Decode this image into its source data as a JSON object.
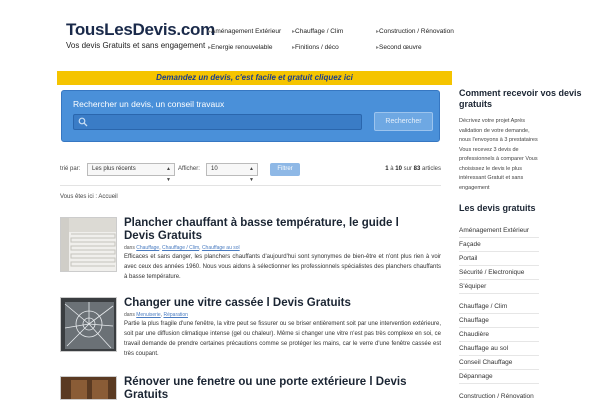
{
  "header": {
    "logo": "TousLesDevis.com",
    "tagline": "Vos devis Gratuits et sans engagement",
    "nav_col1": [
      "Aménagement Extérieur",
      "Energie renouvelable"
    ],
    "nav_col2": [
      "Chauffage / Clim",
      "Finitions / déco"
    ],
    "nav_col3": [
      "Construction / Rénovation",
      "Second œuvre"
    ]
  },
  "banner": "Demandez un devis, c'est facile et gratuit cliquez ici",
  "search": {
    "title": "Rechercher un devis, un conseil travaux",
    "placeholder": "",
    "button": "Rechercher"
  },
  "filters": {
    "sort_label": "trié par:",
    "sort_value": "Les plus récents",
    "show_label": "Afficher:",
    "show_value": "10",
    "filter_button": "Filtrer",
    "count_from": "1",
    "count_sep": "à",
    "count_to": "10",
    "count_of": "sur",
    "count_total": "83",
    "count_suffix": "articles"
  },
  "breadcrumb": "Vous êtes ici : Accueil",
  "articles": [
    {
      "title": "Plancher chauffant à basse température, le guide l Devis Gratuits",
      "meta_prefix": "dans",
      "tags": [
        "Chauffage",
        "Chauffage / Clim",
        "Chauffage au sol"
      ],
      "excerpt": "Efficaces et sans danger, les planchers chauffants d'aujourd'hui sont synonymes de bien-être et n'ont plus rien à voir avec ceux des années 1960. Nous vous aidons à sélectionner les professionnels spécialistes des planchers chauffants à basse température."
    },
    {
      "title": "Changer une vitre cassée l Devis Gratuits",
      "meta_prefix": "dans",
      "tags": [
        "Menuiserie",
        "Réparation"
      ],
      "excerpt": "Partie la plus fragile d'une fenêtre, la vitre peut se fissurer ou se briser entièrement soit par une intervention extérieure, soit par une diffusion climatique intense (gel ou chaleur). Même si changer une vitre n'est pas très complexe en soi, ce travail demande de prendre certaines précautions comme se protéger les mains, car le verre d'une fenêtre cassée est très coupant."
    },
    {
      "title": "Rénover une fenetre ou une porte extérieure l Devis Gratuits"
    }
  ],
  "sidebar": {
    "heading1": "Comment recevoir vos devis gratuits",
    "text": "Décrivez votre projet Après validation de votre demande, nous l'envoyons à 3 prestataires Vous recevez 3 devis de professionnels à comparer Vous choisissez le devis le plus intéressant Gratuit et sans engagement",
    "heading2": "Les devis gratuits",
    "items": [
      "Aménagement Extérieur",
      "Façade",
      "Portail",
      "Sécurité / Electronique",
      "S'équiper",
      "Chauffage / Clim",
      "Chauffage",
      "Chaudière",
      "Chauffage au sol",
      "Conseil Chauffage",
      "Dépannage",
      "Construction / Rénovation"
    ]
  }
}
